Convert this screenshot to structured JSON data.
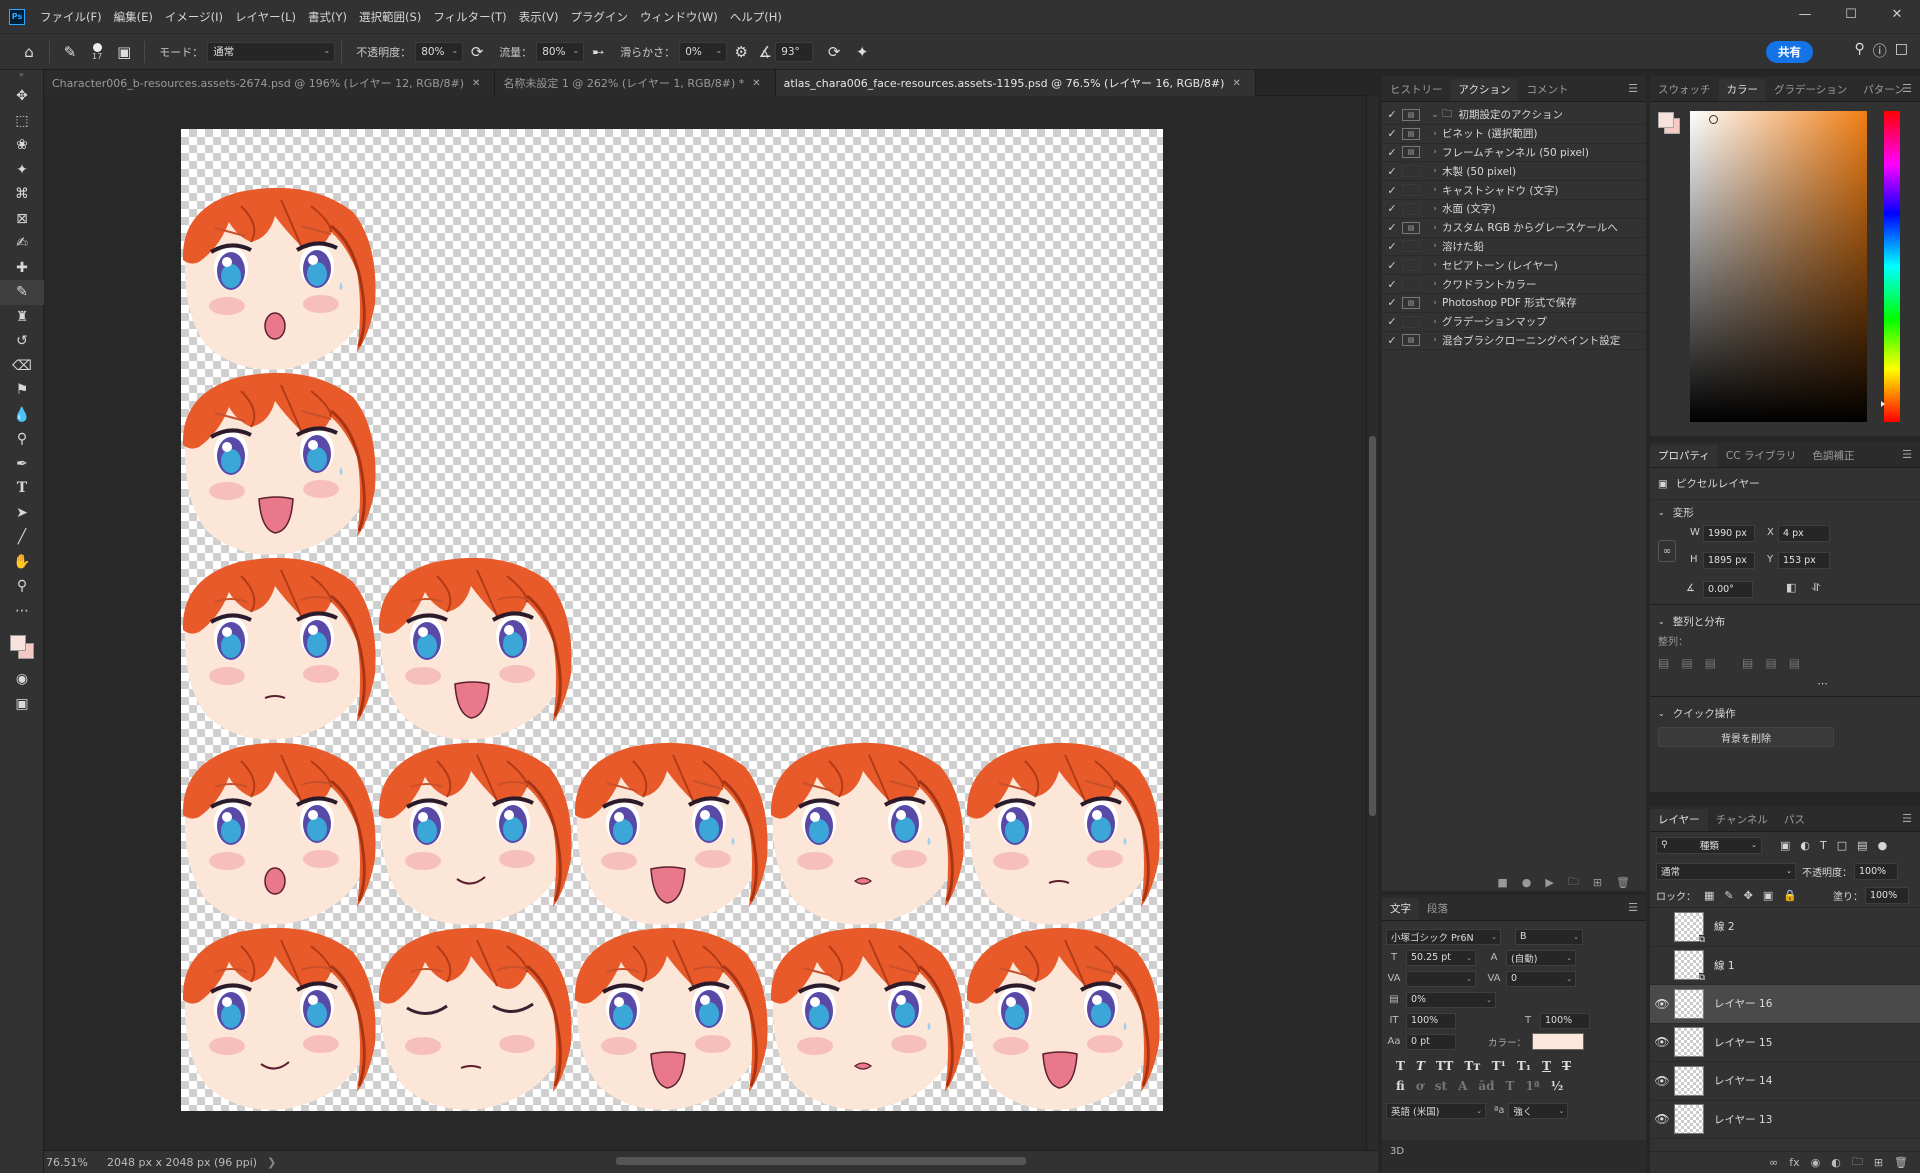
{
  "menubar": {
    "app_badge": "Ps",
    "items": [
      "ファイル(F)",
      "編集(E)",
      "イメージ(I)",
      "レイヤー(L)",
      "書式(Y)",
      "選択範囲(S)",
      "フィルター(T)",
      "表示(V)",
      "プラグイン",
      "ウィンドウ(W)",
      "ヘルプ(H)"
    ]
  },
  "options": {
    "brush_size": "17",
    "mode_label": "モード：",
    "mode_value": "通常",
    "opacity_label": "不透明度：",
    "opacity_value": "80%",
    "flow_label": "流量：",
    "flow_value": "80%",
    "smooth_label": "滑らかさ：",
    "smooth_value": "0%",
    "angle_value": "93°",
    "share_label": "共有"
  },
  "tabs": [
    {
      "label": "Character006_b-resources.assets-2674.psd @ 196% (レイヤー 12, RGB/8#)",
      "active": false
    },
    {
      "label": "名称未設定 1 @ 262% (レイヤー 1, RGB/8#) *",
      "active": false
    },
    {
      "label": "atlas_chara006_face-resources.assets-1195.psd @ 76.5% (レイヤー 16, RGB/8#)",
      "active": true
    }
  ],
  "status": {
    "zoom": "76.51%",
    "doc_info": "2048 px x 2048 px (96 ppi)"
  },
  "actions_panel": {
    "tabs": [
      "ヒストリー",
      "アクション",
      "コメント"
    ],
    "set_name": "初期設定のアクション",
    "items": [
      {
        "label": "ビネット (選択範囲)",
        "dialog": true
      },
      {
        "label": "フレームチャンネル (50 pixel)",
        "dialog": true
      },
      {
        "label": "木製 (50 pixel)",
        "dialog": false
      },
      {
        "label": "キャストシャドウ (文字)",
        "dialog": false
      },
      {
        "label": "水面 (文字)",
        "dialog": false
      },
      {
        "label": "カスタム RGB からグレースケールへ",
        "dialog": true
      },
      {
        "label": "溶けた鉛",
        "dialog": false
      },
      {
        "label": "セピアトーン (レイヤー)",
        "dialog": false
      },
      {
        "label": "クワドラントカラー",
        "dialog": false
      },
      {
        "label": "Photoshop PDF 形式で保存",
        "dialog": true
      },
      {
        "label": "グラデーションマップ",
        "dialog": false
      },
      {
        "label": "混合ブラシクローニングペイント設定",
        "dialog": true
      }
    ]
  },
  "char_panel": {
    "tabs": [
      "文字",
      "段落"
    ],
    "font": "小塚ゴシック Pr6N",
    "style": "B",
    "size": "50.25 pt",
    "leading": "(自動)",
    "kerning": "",
    "tracking": "0",
    "tsume": "0%",
    "vscale": "100%",
    "hscale": "100%",
    "baseline": "0 pt",
    "color_label": "カラー：",
    "language": "英語 (米国)",
    "aa_label": "ªa",
    "aa_value": "強く",
    "threed": "3D"
  },
  "color_panel": {
    "tabs": [
      "スウォッチ",
      "カラー",
      "グラデーション",
      "パターン"
    ],
    "fg": "#f7e3dc",
    "bg": "#f5c9c4"
  },
  "props": {
    "tabs": [
      "プロパティ",
      "CC ライブラリ",
      "色調補正"
    ],
    "layer_type": "ピクセルレイヤー",
    "transform_title": "変形",
    "w_label": "W",
    "w": "1990 px",
    "x_label": "X",
    "x": "4 px",
    "h_label": "H",
    "h": "1895 px",
    "y_label": "Y",
    "y": "153 px",
    "angle": "0.00°",
    "align_title": "整列と分布",
    "align_label": "整列：",
    "quick_title": "クイック操作",
    "remove_bg": "背景を削除"
  },
  "layers": {
    "tabs": [
      "レイヤー",
      "チャンネル",
      "パス"
    ],
    "filter": "種類",
    "blend": "通常",
    "opacity_label": "不透明度：",
    "opacity": "100%",
    "lock_label": "ロック：",
    "fill_label": "塗り：",
    "fill": "100%",
    "items": [
      {
        "name": "線 2",
        "visible": false,
        "selected": false
      },
      {
        "name": "線 1",
        "visible": false,
        "selected": false
      },
      {
        "name": "レイヤー 16",
        "visible": true,
        "selected": true
      },
      {
        "name": "レイヤー 15",
        "visible": true,
        "selected": false
      },
      {
        "name": "レイヤー 14",
        "visible": true,
        "selected": false
      },
      {
        "name": "レイヤー 13",
        "visible": true,
        "selected": false
      }
    ]
  },
  "faces": [
    {
      "eyes": "worried",
      "mouth": "o-small"
    },
    {
      "eyes": "worried",
      "mouth": "open"
    },
    {
      "eyes": "normal",
      "mouth": "line"
    },
    {
      "eyes": "normal",
      "mouth": "open"
    },
    {
      "eyes": "normal",
      "mouth": "o-small"
    },
    {
      "eyes": "normal",
      "mouth": "smile"
    },
    {
      "eyes": "worried",
      "mouth": "open"
    },
    {
      "eyes": "worried",
      "mouth": "tiny"
    },
    {
      "eyes": "worried",
      "mouth": "line"
    },
    {
      "eyes": "normal",
      "mouth": "smile"
    },
    {
      "eyes": "closed",
      "mouth": "line"
    },
    {
      "eyes": "normal",
      "mouth": "open"
    },
    {
      "eyes": "worried",
      "mouth": "tiny"
    },
    {
      "eyes": "worried",
      "mouth": "open"
    }
  ]
}
